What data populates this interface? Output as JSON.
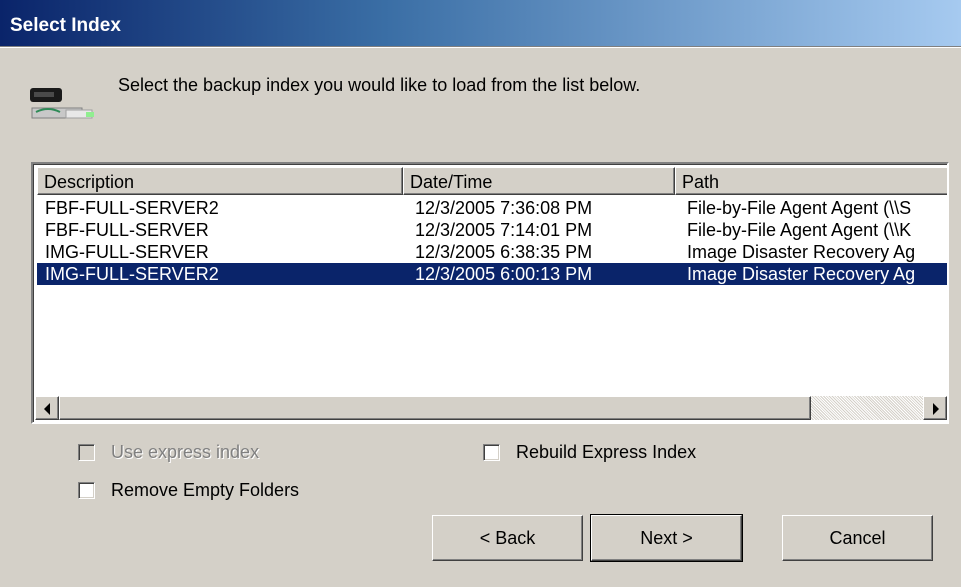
{
  "window": {
    "title": "Select Index"
  },
  "header": {
    "instruction": "Select the backup index you would like to load from the list below.",
    "icon": "tape-drive-icon"
  },
  "list": {
    "columns": [
      "Description",
      "Date/Time",
      "Path"
    ],
    "rows": [
      {
        "description": "FBF-FULL-SERVER2",
        "datetime": "12/3/2005 7:36:08 PM",
        "path": "File-by-File Agent Agent (\\\\S"
      },
      {
        "description": "FBF-FULL-SERVER",
        "datetime": "12/3/2005 7:14:01 PM",
        "path": "File-by-File Agent Agent (\\\\K"
      },
      {
        "description": "IMG-FULL-SERVER",
        "datetime": "12/3/2005 6:38:35 PM",
        "path": "Image Disaster Recovery Ag"
      },
      {
        "description": "IMG-FULL-SERVER2",
        "datetime": "12/3/2005 6:00:13 PM",
        "path": "Image Disaster Recovery Ag"
      }
    ],
    "selected_index": 3
  },
  "options": {
    "use_express_index": {
      "label": "Use express index",
      "checked": false,
      "disabled": true
    },
    "rebuild_express_index": {
      "label": "Rebuild Express Index",
      "checked": false
    },
    "remove_empty_folders": {
      "label": "Remove Empty Folders",
      "checked": false
    }
  },
  "buttons": {
    "back": "< Back",
    "next": "Next >",
    "cancel": "Cancel"
  },
  "colors": {
    "selection": "#0a246a",
    "face": "#d4d0c8",
    "title_start": "#0a246a",
    "title_end": "#a6caf0"
  }
}
